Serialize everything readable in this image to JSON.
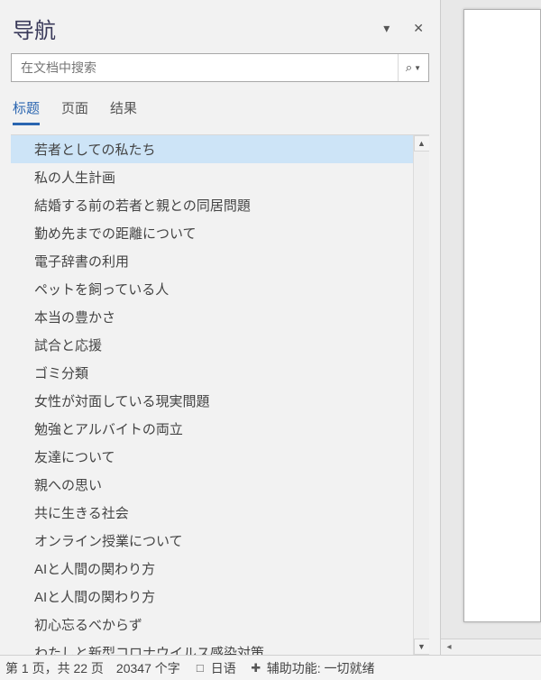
{
  "pane": {
    "title": "导航"
  },
  "search": {
    "placeholder": "在文档中搜索",
    "icon": "⌕"
  },
  "tabs": [
    {
      "label": "标题",
      "active": true
    },
    {
      "label": "页面",
      "active": false
    },
    {
      "label": "结果",
      "active": false
    }
  ],
  "headings": [
    {
      "text": "若者としての私たち",
      "selected": true
    },
    {
      "text": "私の人生計画"
    },
    {
      "text": "結婚する前の若者と親との同居問題"
    },
    {
      "text": "勤め先までの距離について"
    },
    {
      "text": "電子辞書の利用"
    },
    {
      "text": "ペットを飼っている人"
    },
    {
      "text": "本当の豊かさ"
    },
    {
      "text": "試合と応援"
    },
    {
      "text": "ゴミ分類"
    },
    {
      "text": "女性が対面している現実間題"
    },
    {
      "text": "勉強とアルバイトの両立"
    },
    {
      "text": "友達について"
    },
    {
      "text": "親への思い"
    },
    {
      "text": "共に生きる社会"
    },
    {
      "text": "オンライン授業について"
    },
    {
      "text": "AIと人間の関わり方"
    },
    {
      "text": "AIと人間の関わり方"
    },
    {
      "text": "初心忘るべからず"
    },
    {
      "text": "わたしと新型コロナウイルス感染対策"
    }
  ],
  "status": {
    "page": "第 1 页，共 22 页",
    "words": "20347 个字",
    "language": "日语",
    "accessibility": "辅助功能: 一切就绪"
  }
}
